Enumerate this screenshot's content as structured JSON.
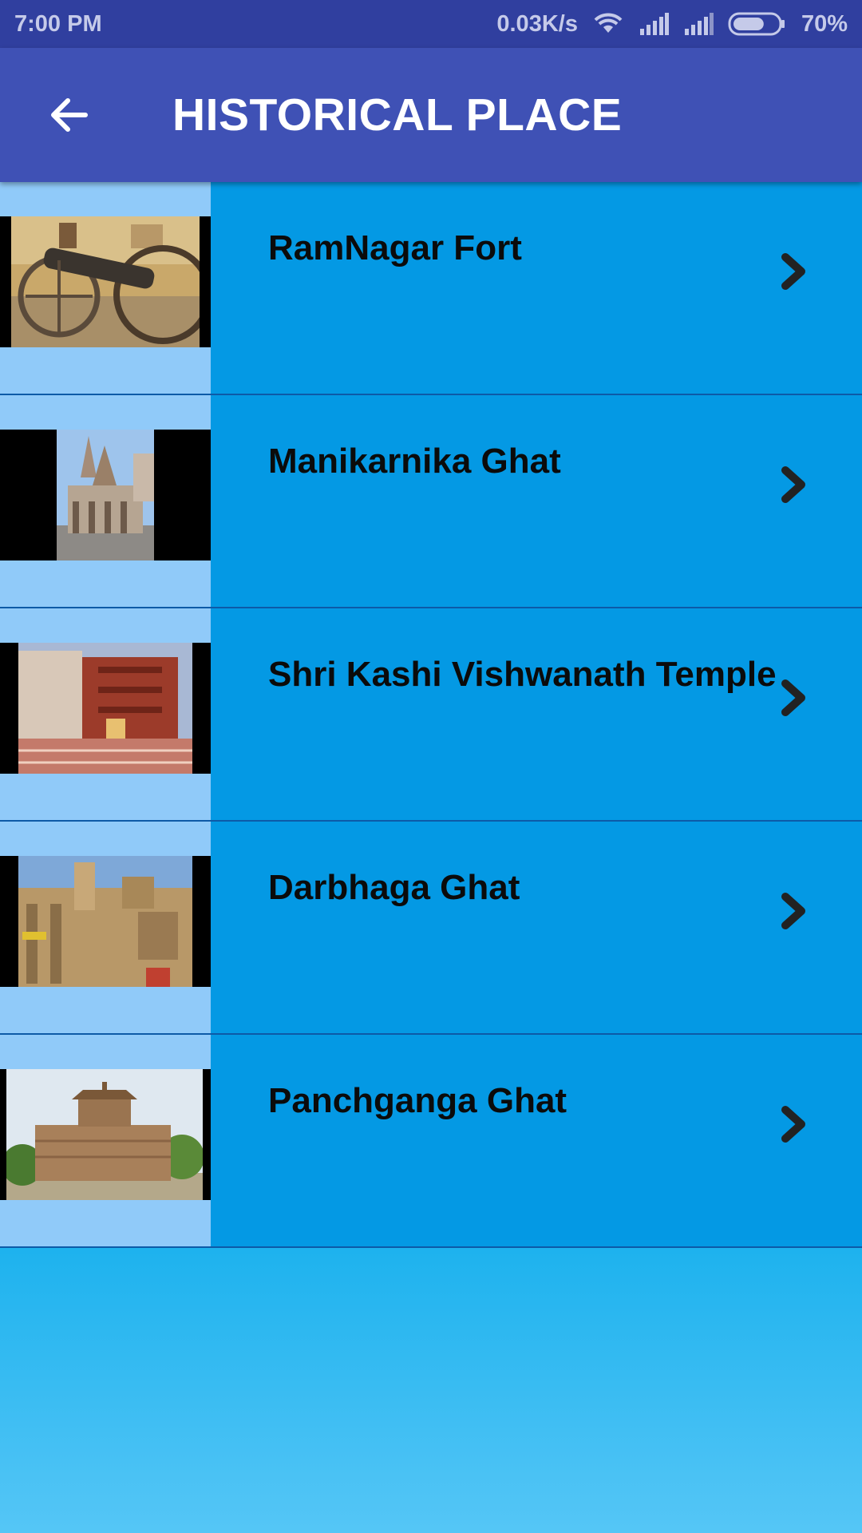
{
  "status_bar": {
    "time": "7:00 PM",
    "speed": "0.03K/s",
    "battery": "70%",
    "battery_level": 0.7,
    "icons": [
      "wifi-icon",
      "signal-icon",
      "signal-icon",
      "battery-icon"
    ]
  },
  "app_bar": {
    "title": "HISTORICAL PLACE",
    "back_icon": "arrow-back-icon"
  },
  "places": [
    {
      "name": "RamNagar Fort",
      "thumb": "cannon photo"
    },
    {
      "name": "Manikarnika Ghat",
      "thumb": "temple photo"
    },
    {
      "name": "Shri Kashi Vishwanath Temple",
      "thumb": "ghat building photo"
    },
    {
      "name": "Darbhaga Ghat",
      "thumb": "palace photo"
    },
    {
      "name": "Panchganga Ghat",
      "thumb": "pavilion photo"
    }
  ],
  "colors": {
    "status_bar": "#303f9f",
    "app_bar": "#3f51b5",
    "row_content": "#0499e4",
    "thumb_column": "#90caf9",
    "background": "#1db2ee"
  }
}
